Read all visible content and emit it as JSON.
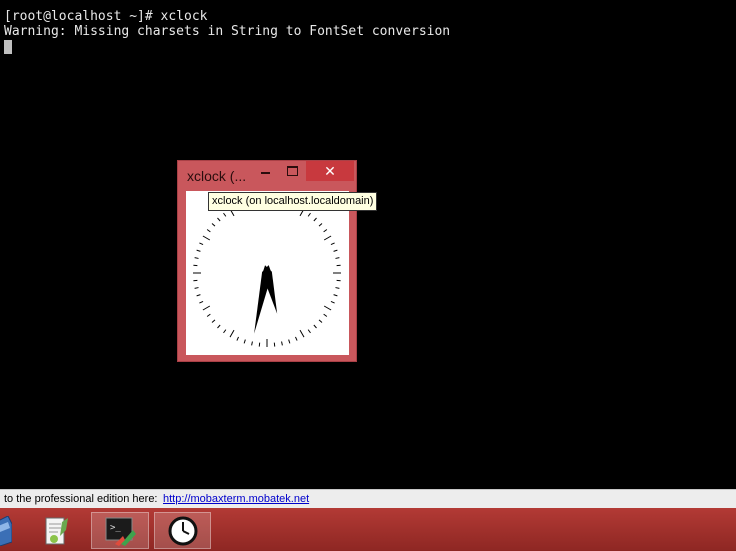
{
  "terminal": {
    "prompt_line": "[root@localhost ~]# xclock",
    "warning_line": "Warning: Missing charsets in String to FontSet conversion"
  },
  "xclock_window": {
    "title": "xclock (...",
    "close_glyph": "✕",
    "tooltip": "xclock (on localhost.localdomain)",
    "time": {
      "hour": 5,
      "minute": 32
    }
  },
  "status_bar": {
    "message": "to the professional edition here:",
    "link": "http://mobaxterm.mobatek.net"
  },
  "taskbar": {
    "items": [
      {
        "icon": "virtualbox-icon"
      },
      {
        "icon": "notepad-plus-plus-icon"
      },
      {
        "icon": "mobaxterm-icon",
        "active": true
      },
      {
        "icon": "xclock-icon",
        "active": true
      }
    ]
  },
  "colors": {
    "window_frame": "#c9575c",
    "close_button": "#c8393e",
    "taskbar": "#a8342f",
    "link": "#0000cc"
  }
}
